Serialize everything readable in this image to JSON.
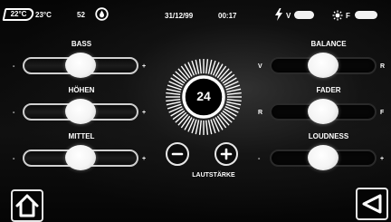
{
  "status": {
    "outside_temp": "22°C",
    "inside_temp": "23°C",
    "humidity": "52",
    "date": "31/12/99",
    "time": "00:17",
    "volt_label": "V",
    "fuel_label": "F"
  },
  "sliders_left": [
    {
      "label": "BASS",
      "min": "-",
      "max": "+",
      "value_fraction": 0.5
    },
    {
      "label": "HÖHEN",
      "min": "-",
      "max": "+",
      "value_fraction": 0.5
    },
    {
      "label": "MITTEL",
      "min": "-",
      "max": "+",
      "value_fraction": 0.5
    }
  ],
  "sliders_right": [
    {
      "label": "BALANCE",
      "min": "V",
      "max": "R",
      "value_fraction": 0.5
    },
    {
      "label": "FADER",
      "min": "R",
      "max": "F",
      "value_fraction": 0.5
    },
    {
      "label": "LOUDNESS",
      "min": "-",
      "max": "+",
      "value_fraction": 0.5
    }
  ],
  "volume": {
    "value": "24",
    "label": "LAUTSTÄRKE",
    "minus_icon": "minus-icon",
    "plus_icon": "plus-icon"
  },
  "icons": {
    "home": "home-icon",
    "back": "back-triangle-icon",
    "bolt": "lightning-icon",
    "sun": "sun-icon",
    "drop": "drop-icon"
  },
  "colors": {
    "foreground": "#ffffff",
    "background": "#000000",
    "knob": "#f4f4f4"
  }
}
